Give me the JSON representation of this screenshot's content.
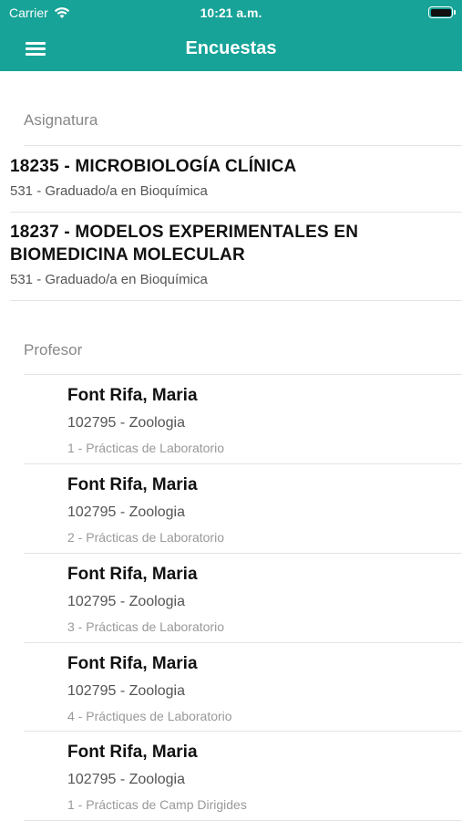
{
  "status": {
    "carrier": "Carrier",
    "time": "10:21 a.m."
  },
  "navbar": {
    "title": "Encuestas"
  },
  "asignatura": {
    "header": "Asignatura",
    "items": [
      {
        "title": "18235 - MICROBIOLOGÍA CLÍNICA",
        "subtitle": "531 - Graduado/a en Bioquímica"
      },
      {
        "title_line1": "18237 - MODELOS EXPERIMENTALES EN",
        "title_line2": "BIOMEDICINA MOLECULAR",
        "subtitle": "531 - Graduado/a en Bioquímica"
      }
    ]
  },
  "profesor": {
    "header": "Profesor",
    "items": [
      {
        "name": "Font Rifa, Maria",
        "dept": "102795 - Zoologia",
        "group": "1 - Prácticas de Laboratorio"
      },
      {
        "name": "Font Rifa, Maria",
        "dept": "102795 - Zoologia",
        "group": "2 - Prácticas de Laboratorio"
      },
      {
        "name": "Font Rifa, Maria",
        "dept": "102795 - Zoologia",
        "group": "3 - Prácticas de Laboratorio"
      },
      {
        "name": "Font Rifa, Maria",
        "dept": "102795 - Zoologia",
        "group": "4 - Práctiques de Laboratorio"
      },
      {
        "name": "Font Rifa, Maria",
        "dept": "102795 - Zoologia",
        "group": "1 - Prácticas de Camp Dirigides"
      }
    ]
  }
}
